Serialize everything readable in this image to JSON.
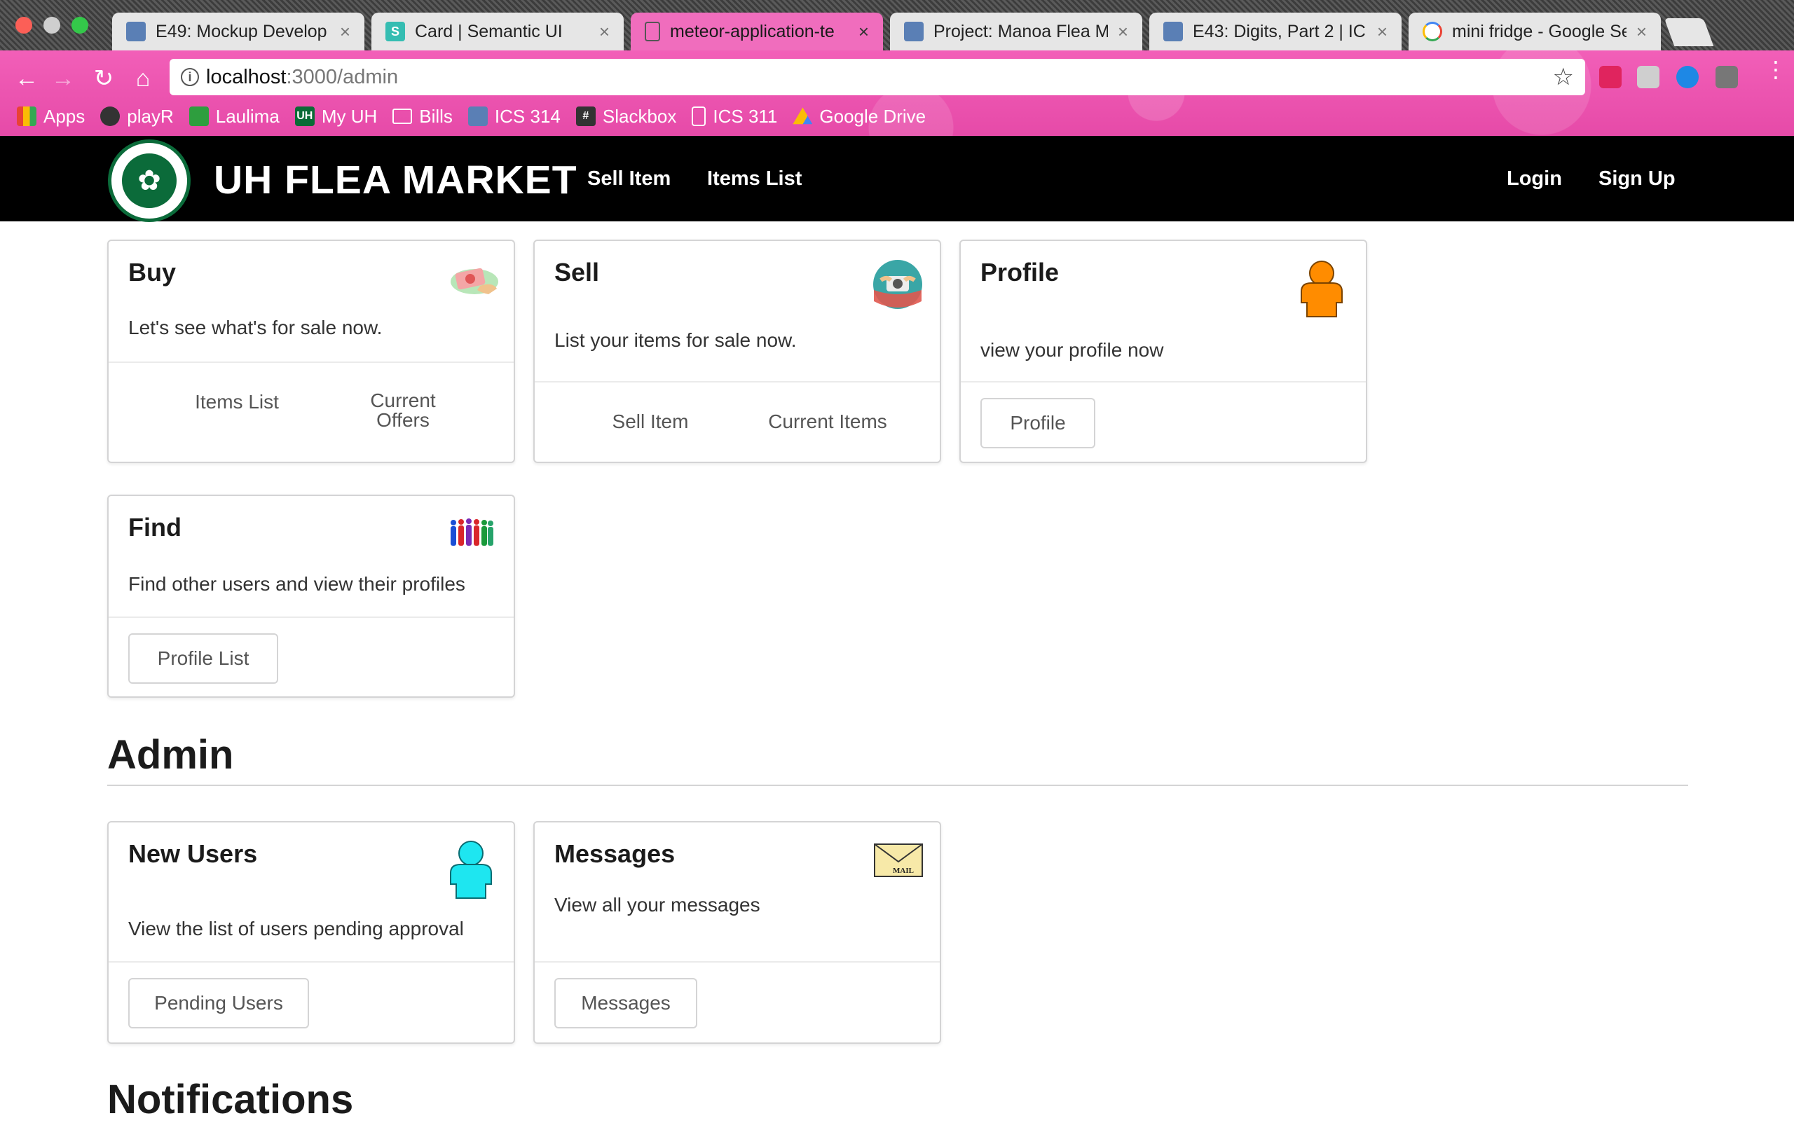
{
  "browser": {
    "tabs": [
      {
        "title": "E49: Mockup Develop",
        "favicon": "square-favicon",
        "color": "#5a7fb5"
      },
      {
        "title": "Card | Semantic UI",
        "favicon": "s-favicon",
        "color": "#35bdb2"
      },
      {
        "title": "meteor-application-te",
        "favicon": "doc-favicon",
        "color": "#ffffff",
        "active": true
      },
      {
        "title": "Project: Manoa Flea M",
        "favicon": "square-favicon",
        "color": "#5a7fb5"
      },
      {
        "title": "E43: Digits, Part 2 | IC",
        "favicon": "square-favicon",
        "color": "#5a7fb5"
      },
      {
        "title": "mini fridge - Google Se",
        "favicon": "google-favicon",
        "color": "#ffffff"
      }
    ],
    "close_glyph": "×",
    "url_host": "localhost",
    "url_path": ":3000/admin",
    "info_glyph": "i",
    "bookmarks": [
      {
        "label": "Apps",
        "color": "#e94235"
      },
      {
        "label": "playR",
        "color": "#333333"
      },
      {
        "label": "Laulima",
        "color": "#2e9e3e"
      },
      {
        "label": "My UH",
        "color": "#0a6b36"
      },
      {
        "label": "Bills",
        "color": "#eeeeee"
      },
      {
        "label": "ICS 314",
        "color": "#5a7fb5"
      },
      {
        "label": "Slackbox",
        "color": "#333333"
      },
      {
        "label": "ICS 311",
        "color": "#eeeeee"
      },
      {
        "label": "Google Drive",
        "color": "#f4b400"
      }
    ]
  },
  "site": {
    "brand": "UH FLEA MARKET",
    "nav": {
      "sell_item": "Sell Item",
      "items_list": "Items List",
      "login": "Login",
      "sign_up": "Sign Up"
    }
  },
  "cards": {
    "buy": {
      "title": "Buy",
      "desc": "Let's see what's for sale now.",
      "link1": "Items List",
      "link2_line1": "Current",
      "link2_line2": "Offers"
    },
    "sell": {
      "title": "Sell",
      "desc": "List your items for sale now.",
      "link1": "Sell Item",
      "link2": "Current Items"
    },
    "profile": {
      "title": "Profile",
      "desc": "view your profile now",
      "button": "Profile"
    },
    "find": {
      "title": "Find",
      "desc": "Find other users and view their profiles",
      "button": "Profile List"
    },
    "new_users": {
      "title": "New Users",
      "desc": "View the list of users pending approval",
      "button": "Pending Users"
    },
    "messages": {
      "title": "Messages",
      "desc": "View all your messages",
      "button": "Messages",
      "mail_label": "MAIL"
    }
  },
  "sections": {
    "admin": "Admin",
    "notifications": "Notifications"
  },
  "colors": {
    "chrome_pink": "#f06dbd",
    "profile_orange": "#ff8c00",
    "new_users_cyan": "#1ee6f0",
    "uh_green": "#0b6b3a"
  }
}
